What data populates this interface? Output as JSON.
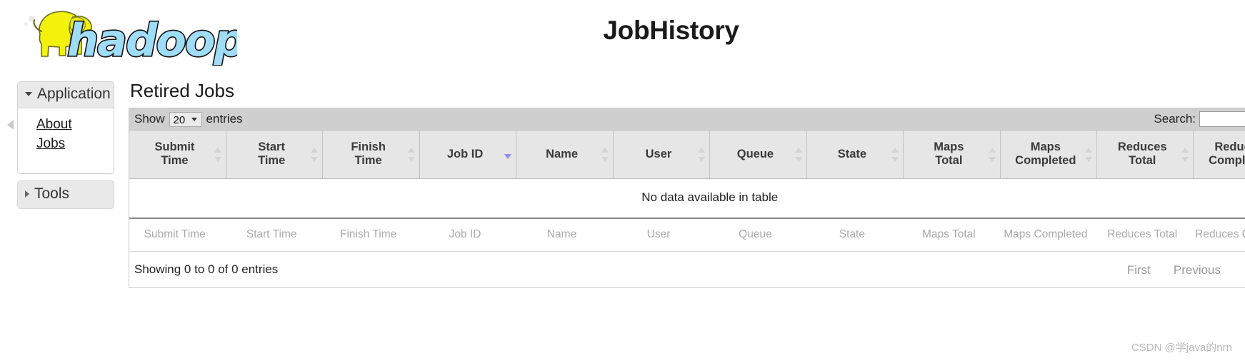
{
  "header": {
    "title": "JobHistory",
    "logo_alt": "hadoop",
    "logo_wordmark": "hadoop"
  },
  "sidebar": {
    "application": {
      "label": "Application",
      "expanded": true,
      "items": [
        {
          "label": "About"
        },
        {
          "label": "Jobs"
        }
      ]
    },
    "tools": {
      "label": "Tools",
      "expanded": false
    }
  },
  "main": {
    "section_title": "Retired Jobs",
    "controls": {
      "show_prefix": "Show",
      "page_length_value": "20",
      "page_length_options": [
        "20"
      ],
      "entries_suffix": "entries",
      "search_label": "Search:",
      "search_value": "",
      "search_placeholder": ""
    },
    "table": {
      "columns": [
        "Submit Time",
        "Start Time",
        "Finish Time",
        "Job ID",
        "Name",
        "User",
        "Queue",
        "State",
        "Maps Total",
        "Maps Completed",
        "Reduces Total",
        "Reduces Completed"
      ],
      "columns_two_line": [
        [
          "Submit",
          "Time"
        ],
        [
          "Start",
          "Time"
        ],
        [
          "Finish",
          "Time"
        ],
        [
          "Job ID",
          ""
        ],
        [
          "Name",
          ""
        ],
        [
          "User",
          ""
        ],
        [
          "Queue",
          ""
        ],
        [
          "State",
          ""
        ],
        [
          "Maps",
          "Total"
        ],
        [
          "Maps",
          "Completed"
        ],
        [
          "Reduces",
          "Total"
        ],
        [
          "Reduces",
          "Completed"
        ]
      ],
      "sorted_column": "Job ID",
      "sort_direction": "desc",
      "rows": [],
      "empty_message": "No data available in table",
      "footer_labels": [
        "Submit Time",
        "Start Time",
        "Finish Time",
        "Job ID",
        "Name",
        "User",
        "Queue",
        "State",
        "Maps Total",
        "Maps Completed",
        "Reduces Total",
        "Reduces Complet"
      ]
    },
    "footer": {
      "info": "Showing 0 to 0 of 0 entries",
      "first_label": "First",
      "previous_label": "Previous"
    }
  },
  "watermark": "CSDN @学java的nrn",
  "colors": {
    "logo_yellow": "#f2f20d",
    "logo_blue": "#9fdcf7",
    "sort_active": "#8f8fe8",
    "control_bar": "#cfcfcf",
    "table_header": "#e6e6e6"
  }
}
